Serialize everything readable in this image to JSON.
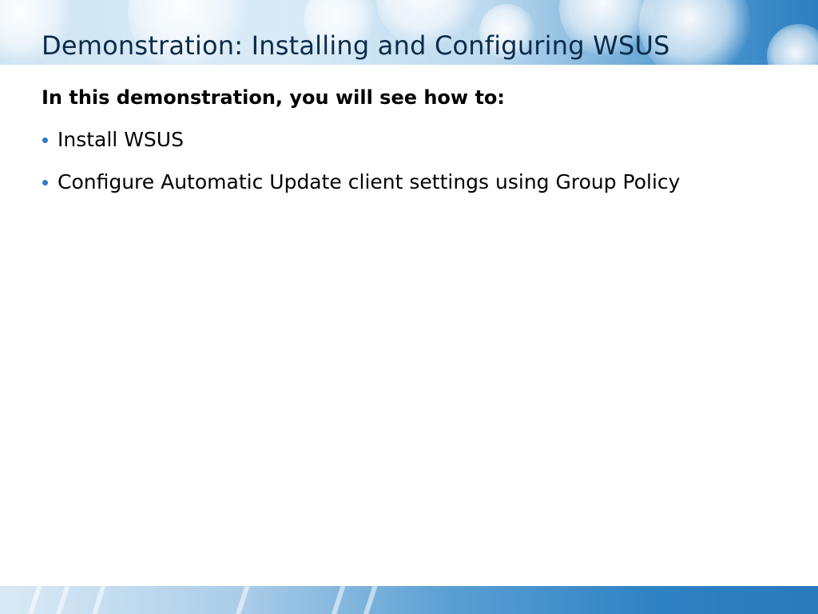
{
  "slide": {
    "title": "Demonstration: Installing and Configuring WSUS",
    "lead": "In this demonstration, you will see how to:",
    "bullets": [
      {
        "text": "Install WSUS"
      },
      {
        "text": "Configure Automatic Update client settings using Group Policy"
      }
    ]
  },
  "colors": {
    "accent": "#2d7cc0",
    "title_text": "#0b2b4a",
    "header_band": "#4f98cf"
  }
}
